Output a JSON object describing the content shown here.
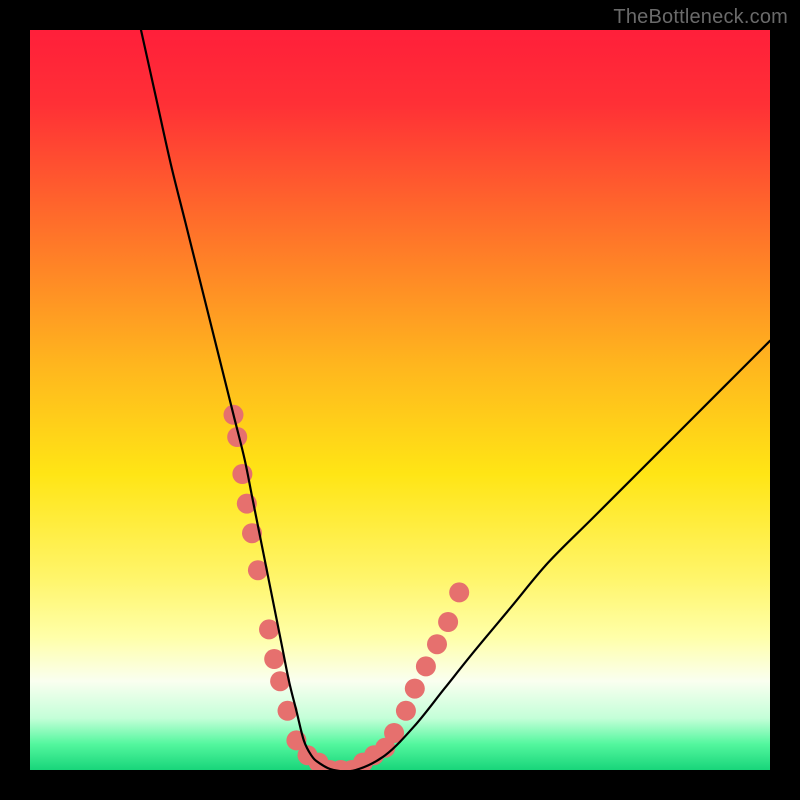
{
  "watermark": {
    "text": "TheBottleneck.com"
  },
  "chart_data": {
    "type": "line",
    "title": "",
    "xlabel": "",
    "ylabel": "",
    "xlim": [
      0,
      100
    ],
    "ylim": [
      0,
      100
    ],
    "grid": false,
    "legend": false,
    "gradient_stops": [
      {
        "pos": 0.0,
        "color": "#ff1f3a"
      },
      {
        "pos": 0.1,
        "color": "#ff3036"
      },
      {
        "pos": 0.25,
        "color": "#ff6a2b"
      },
      {
        "pos": 0.45,
        "color": "#ffb51e"
      },
      {
        "pos": 0.6,
        "color": "#ffe515"
      },
      {
        "pos": 0.74,
        "color": "#fff56a"
      },
      {
        "pos": 0.82,
        "color": "#ffffa8"
      },
      {
        "pos": 0.88,
        "color": "#fafff0"
      },
      {
        "pos": 0.93,
        "color": "#c4ffd8"
      },
      {
        "pos": 0.965,
        "color": "#53f79e"
      },
      {
        "pos": 1.0,
        "color": "#18d57a"
      }
    ],
    "series": [
      {
        "name": "bottleneck-curve",
        "color": "#000000",
        "x": [
          15,
          17,
          19,
          21,
          23,
          24.5,
          26,
          27.5,
          29,
          30,
          31,
          32,
          33,
          34,
          35,
          36,
          37,
          38,
          39,
          41,
          44,
          48,
          52,
          56,
          60,
          65,
          70,
          76,
          82,
          88,
          94,
          100
        ],
        "y": [
          100,
          91,
          82,
          74,
          66,
          60,
          54,
          48,
          42,
          37,
          32,
          27,
          22,
          17,
          12,
          8,
          4,
          2,
          1,
          0,
          0,
          2,
          6,
          11,
          16,
          22,
          28,
          34,
          40,
          46,
          52,
          58
        ]
      }
    ],
    "markers": {
      "name": "highlighted-points",
      "color": "#e6706e",
      "radius": 10,
      "points": [
        {
          "x": 27.5,
          "y": 48
        },
        {
          "x": 28.0,
          "y": 45
        },
        {
          "x": 28.7,
          "y": 40
        },
        {
          "x": 29.3,
          "y": 36
        },
        {
          "x": 30.0,
          "y": 32
        },
        {
          "x": 30.8,
          "y": 27
        },
        {
          "x": 32.3,
          "y": 19
        },
        {
          "x": 33.0,
          "y": 15
        },
        {
          "x": 33.8,
          "y": 12
        },
        {
          "x": 34.8,
          "y": 8
        },
        {
          "x": 36.0,
          "y": 4
        },
        {
          "x": 37.5,
          "y": 2
        },
        {
          "x": 39.0,
          "y": 1
        },
        {
          "x": 40.5,
          "y": 0
        },
        {
          "x": 42.0,
          "y": 0
        },
        {
          "x": 43.5,
          "y": 0
        },
        {
          "x": 45.0,
          "y": 1
        },
        {
          "x": 46.5,
          "y": 2
        },
        {
          "x": 48.0,
          "y": 3
        },
        {
          "x": 49.2,
          "y": 5
        },
        {
          "x": 50.8,
          "y": 8
        },
        {
          "x": 52.0,
          "y": 11
        },
        {
          "x": 53.5,
          "y": 14
        },
        {
          "x": 55.0,
          "y": 17
        },
        {
          "x": 56.5,
          "y": 20
        },
        {
          "x": 58.0,
          "y": 24
        }
      ]
    }
  }
}
